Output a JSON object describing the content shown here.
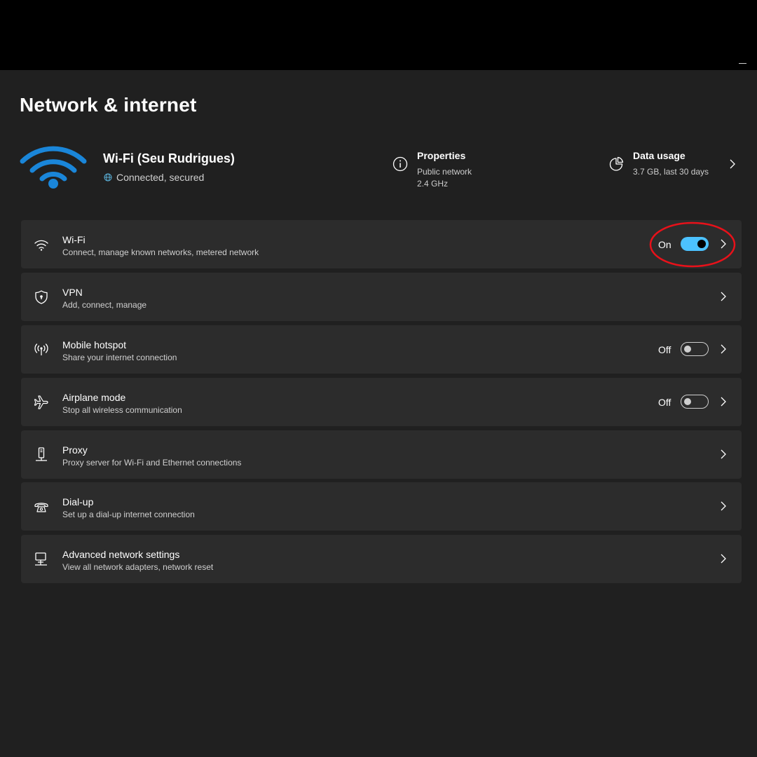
{
  "page_title": "Network & internet",
  "connection": {
    "name": "Wi-Fi (Seu Rudrigues)",
    "status": "Connected, secured",
    "properties": {
      "title": "Properties",
      "line1": "Public network",
      "line2": "2.4 GHz"
    },
    "data_usage": {
      "title": "Data usage",
      "line1": "3.7 GB, last 30 days"
    }
  },
  "colors": {
    "accent": "#4cc2ff",
    "hero_icon": "#1a86d9",
    "background": "#202020",
    "card": "#2c2c2c",
    "highlight": "#e8111a"
  },
  "items": [
    {
      "icon": "wifi-icon",
      "title": "Wi-Fi",
      "subtitle": "Connect, manage known networks, metered network",
      "state": "On",
      "toggle": true
    },
    {
      "icon": "shield-icon",
      "title": "VPN",
      "subtitle": "Add, connect, manage"
    },
    {
      "icon": "hotspot-icon",
      "title": "Mobile hotspot",
      "subtitle": "Share your internet connection",
      "state": "Off",
      "toggle": false
    },
    {
      "icon": "airplane-icon",
      "title": "Airplane mode",
      "subtitle": "Stop all wireless communication",
      "state": "Off",
      "toggle": false
    },
    {
      "icon": "proxy-icon",
      "title": "Proxy",
      "subtitle": "Proxy server for Wi-Fi and Ethernet connections"
    },
    {
      "icon": "dialup-icon",
      "title": "Dial-up",
      "subtitle": "Set up a dial-up internet connection"
    },
    {
      "icon": "network-adapter-icon",
      "title": "Advanced network settings",
      "subtitle": "View all network adapters, network reset"
    }
  ]
}
